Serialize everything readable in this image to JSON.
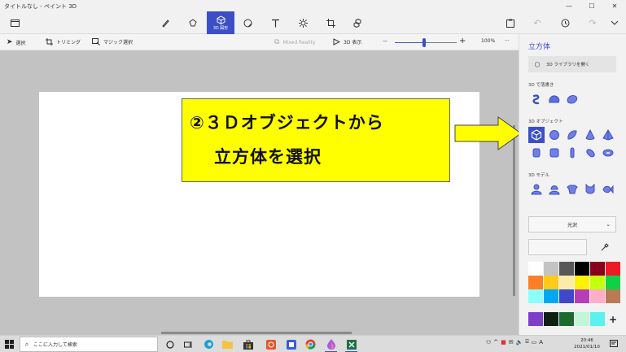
{
  "window": {
    "title": "タイトルなし - ペイント 3D",
    "minimize": "—",
    "maximize": "☐",
    "close": "✕"
  },
  "toolbar": {
    "active_label": "3D 図形"
  },
  "subbar": {
    "select": "選択",
    "crop": "トリミング",
    "magic_select": "マジック選択",
    "mixed_reality": "Mixed Reality",
    "view3d": "3D 表示",
    "zoom_minus": "—",
    "zoom_plus": "+",
    "zoom": "100%",
    "more": "···",
    "zoom_level": 0.45
  },
  "note": {
    "line1": "②３Ｄオブジェクトから",
    "line2": "立方体を選択"
  },
  "panel": {
    "title": "立方体",
    "library_button": "3D ライブラリを開く",
    "doodles_label": "3D で落書き",
    "objects_label": "3D オブジェクト",
    "models_label": "3D モデル",
    "finish_select": "光沢",
    "swatch_colors": [
      "#ffffff",
      "#c3c3c3",
      "#585858",
      "#000000",
      "#88001b",
      "#ec1c24",
      "#ff7f27",
      "#ffca18",
      "#fdeca6",
      "#fff200",
      "#c4ff0e",
      "#0ed145",
      "#8cfffb",
      "#00a8f3",
      "#3f48cc",
      "#b83dba",
      "#ffaec8",
      "#b97a56"
    ],
    "custom_colors": [
      "#7d3fc9",
      "#0f1f14",
      "#1d6a2e",
      "#c2f5da",
      "#5cf0ee"
    ]
  },
  "taskbar": {
    "search_placeholder": "ここに入力して検索",
    "time": "20:46",
    "date": "2021/01/10",
    "ime": "A"
  },
  "colors": {
    "accent": "#3d4fc7",
    "note_bg": "#ffff00"
  }
}
